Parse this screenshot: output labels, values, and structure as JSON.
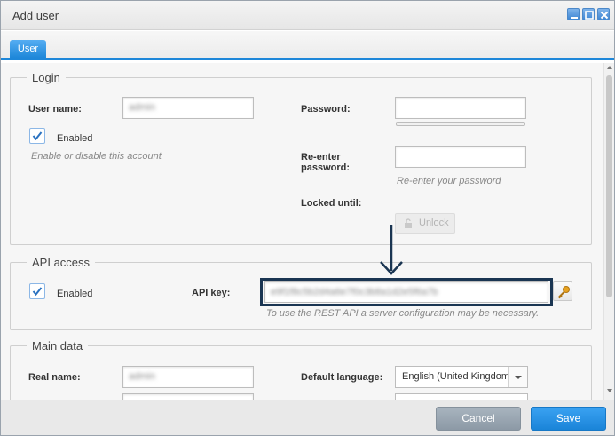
{
  "window": {
    "title": "Add user",
    "controls": [
      "minimize-icon",
      "maximize-icon",
      "close-icon"
    ]
  },
  "tabs": [
    {
      "label": "User",
      "active": true
    }
  ],
  "login": {
    "legend": "Login",
    "username_label": "User name:",
    "username_value": "admin",
    "enabled_label": "Enabled",
    "enabled_checked": true,
    "enabled_hint": "Enable or disable this account",
    "password_label": "Password:",
    "password_value": "",
    "reenter_label_line1": "Re-enter",
    "reenter_label_line2": "password:",
    "reenter_value": "",
    "reenter_hint": "Re-enter your password",
    "locked_label": "Locked until:",
    "unlock_button": "Unlock"
  },
  "api": {
    "legend": "API access",
    "enabled_label": "Enabled",
    "enabled_checked": true,
    "key_label": "API key:",
    "key_value": "e9f1f8c5b2d4a6e7f0c3b8a1d2e5f6a7b",
    "hint": "To use the REST API a server configuration may be necessary.",
    "key_button_icon": "key-icon"
  },
  "main": {
    "legend": "Main data",
    "realname_label": "Real name:",
    "realname_value": "admin",
    "language_label": "Default language:",
    "language_value": "English (United Kingdom)"
  },
  "footer": {
    "cancel_label": "Cancel",
    "save_label": "Save"
  },
  "colors": {
    "accent": "#1e87d9",
    "highlight_border": "#1a3552",
    "cancel_bg": "#97a3af"
  }
}
